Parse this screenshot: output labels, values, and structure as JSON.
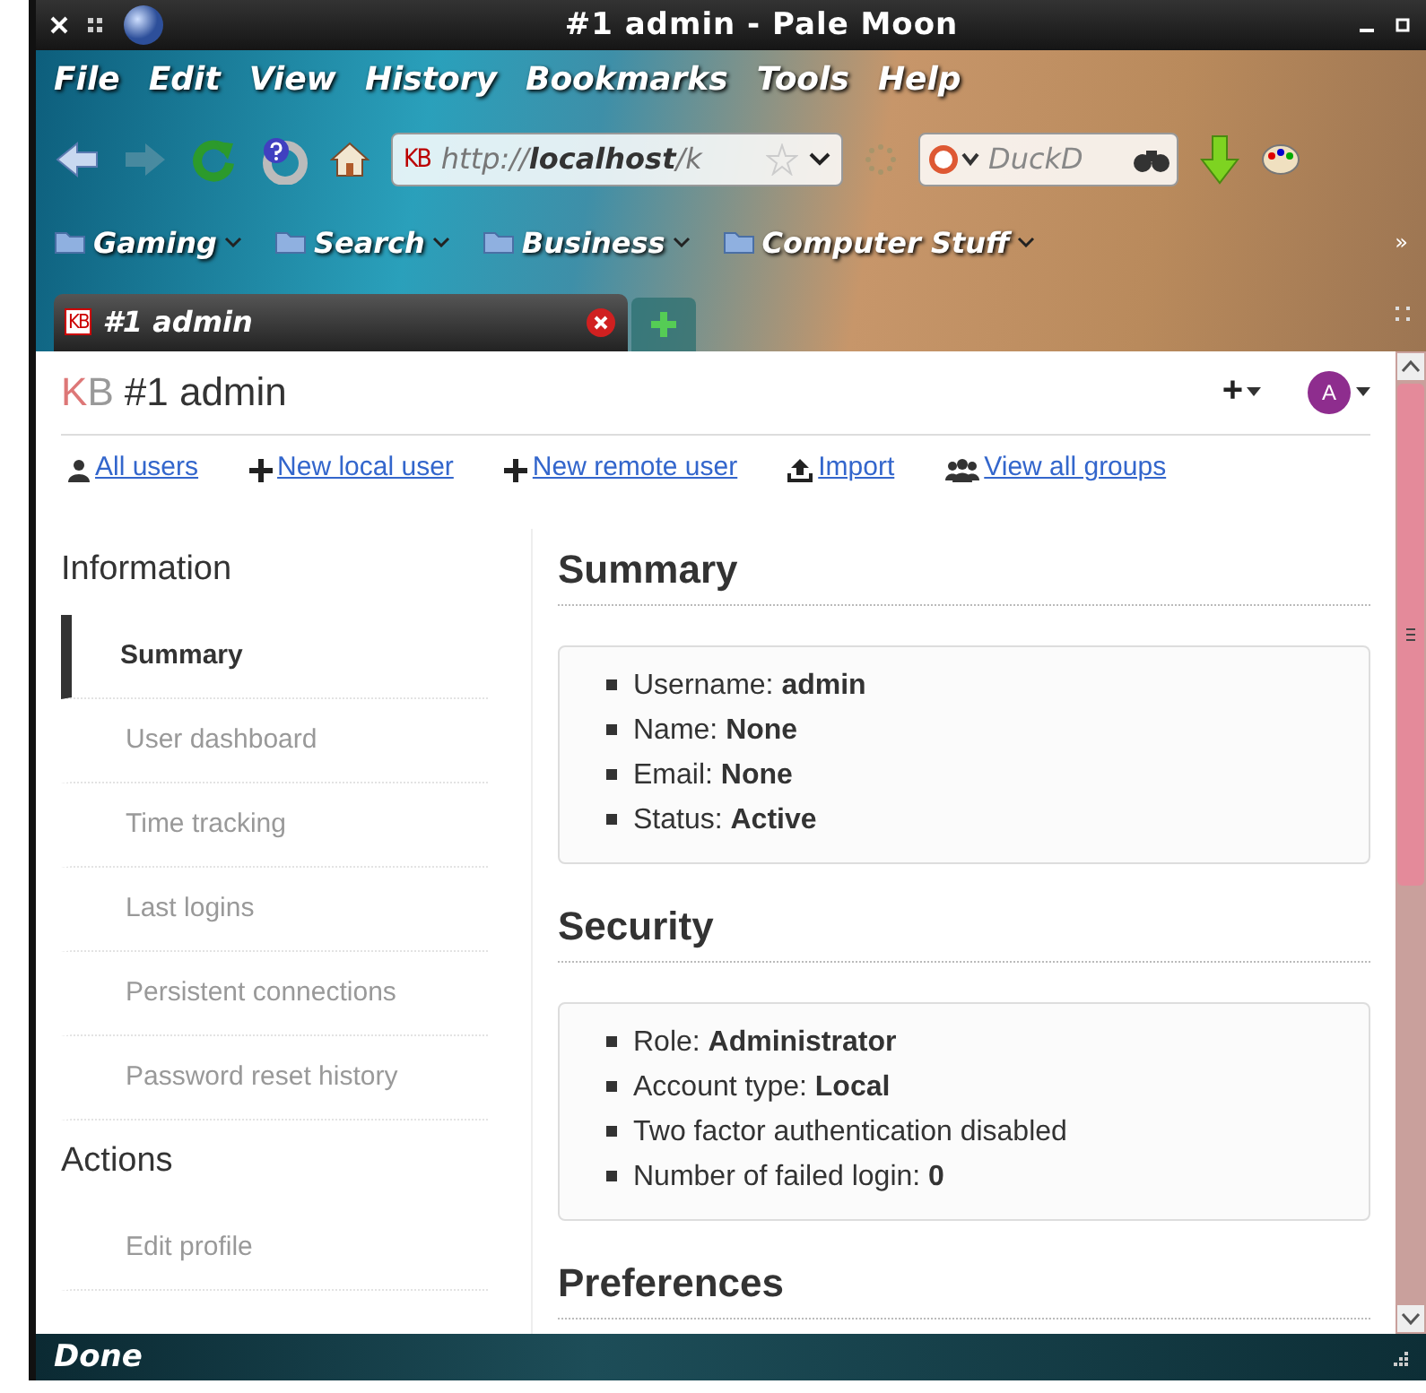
{
  "window": {
    "title": "#1 admin - Pale Moon"
  },
  "menu_bar": [
    "File",
    "Edit",
    "View",
    "History",
    "Bookmarks",
    "Tools",
    "Help"
  ],
  "navigation": {
    "site_badge": "KB",
    "url": "http://**localhost**/k",
    "search_placeholder": "DuckD"
  },
  "bookmarks": {
    "items": [
      "Gaming",
      "Search",
      "Business",
      "Computer Stuff"
    ],
    "overflow": "»"
  },
  "tabs": [
    {
      "badge": "KB",
      "title": "#1 admin",
      "selected": true
    }
  ],
  "page": {
    "logo": "KB",
    "title": "#1 admin",
    "add_menu": "+",
    "avatar": "A",
    "links": [
      {
        "kind": "user",
        "label": "All users"
      },
      {
        "kind": "plus",
        "label": "New local user"
      },
      {
        "kind": "plus",
        "label": "New remote user"
      },
      {
        "kind": "upload",
        "label": "Import"
      },
      {
        "kind": "users",
        "label": "View all groups"
      }
    ]
  },
  "sidebar": [
    {
      "heading": "Information",
      "items": [
        {
          "label": "Summary",
          "selected": true
        },
        {
          "label": "User dashboard",
          "selected": false
        },
        {
          "label": "Time tracking",
          "selected": false
        },
        {
          "label": "Last logins",
          "selected": false
        },
        {
          "label": "Persistent connections",
          "selected": false
        },
        {
          "label": "Password reset history",
          "selected": false
        }
      ]
    },
    {
      "heading": "Actions",
      "items": [
        {
          "label": "Edit profile",
          "selected": false
        }
      ]
    }
  ],
  "sections": [
    {
      "title": "Summary",
      "items": [
        "Username: **admin**",
        "Name: **None**",
        "Email: **None**",
        "Status: **Active**"
      ]
    },
    {
      "title": "Security",
      "items": [
        "Role: **Administrator**",
        "Account type: **Local**",
        "Two factor authentication disabled",
        "Number of failed login: **0**"
      ]
    },
    {
      "title": "Preferences"
    }
  ],
  "status_bar": {
    "text": "Done"
  }
}
